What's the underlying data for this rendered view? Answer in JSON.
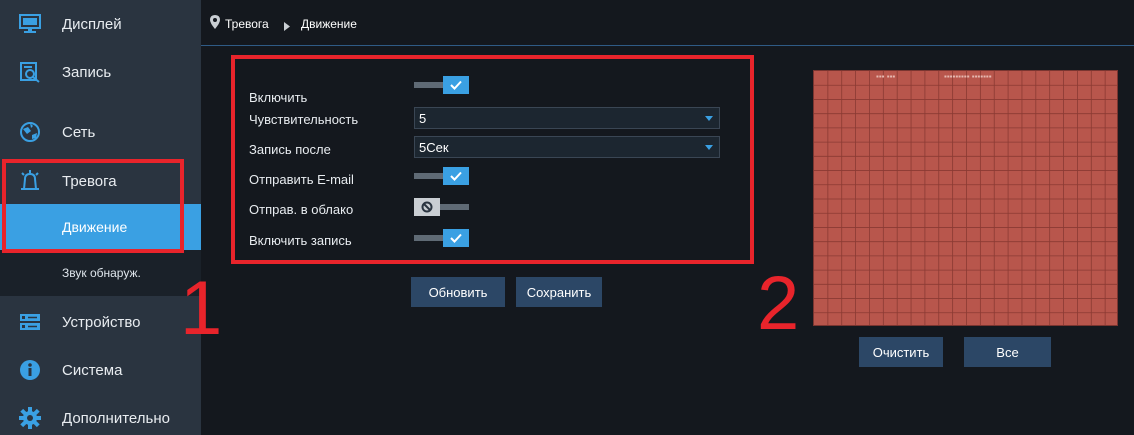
{
  "sidebar": {
    "items": [
      {
        "id": "display",
        "label": "Дисплей",
        "icon": "monitor-icon"
      },
      {
        "id": "record",
        "label": "Запись",
        "icon": "record-search-icon"
      },
      {
        "id": "network",
        "label": "Сеть",
        "icon": "network-globe-icon"
      },
      {
        "id": "alarm",
        "label": "Тревога",
        "icon": "alarm-bell-icon"
      },
      {
        "id": "device",
        "label": "Устройство",
        "icon": "hdd-device-icon"
      },
      {
        "id": "system",
        "label": "Система",
        "icon": "info-icon"
      },
      {
        "id": "advanced",
        "label": "Дополнительно",
        "icon": "gear-icon"
      }
    ],
    "sub_items": [
      {
        "id": "motion",
        "label": "Движение",
        "active": true
      },
      {
        "id": "sound",
        "label": "Звук обнаруж.",
        "active": false
      }
    ]
  },
  "breadcrumb": {
    "items": [
      "Тревога",
      "Движение"
    ],
    "icon": "location-pin-icon"
  },
  "form": {
    "enable": {
      "label": "Включить",
      "value": true
    },
    "sensitivity": {
      "label": "Чувствительность",
      "value": "5"
    },
    "post_record": {
      "label": "Запись после",
      "value": "5Сек"
    },
    "send_email": {
      "label": "Отправить E-mail",
      "value": true
    },
    "send_cloud": {
      "label": "Отправ. в облако",
      "value": false
    },
    "enable_record": {
      "label": "Включить запись",
      "value": true
    }
  },
  "buttons": {
    "refresh": "Обновить",
    "save": "Сохранить",
    "clear": "Очистить",
    "all": "Все"
  },
  "annotations": {
    "one": "1",
    "two": "2"
  },
  "colors": {
    "accent": "#3aa0e3",
    "sidebar_bg": "#2a3440",
    "main_bg": "#14181e",
    "button_bg": "#2c4766",
    "grid_fill": "#b8564c",
    "annotation": "#e8242b"
  }
}
